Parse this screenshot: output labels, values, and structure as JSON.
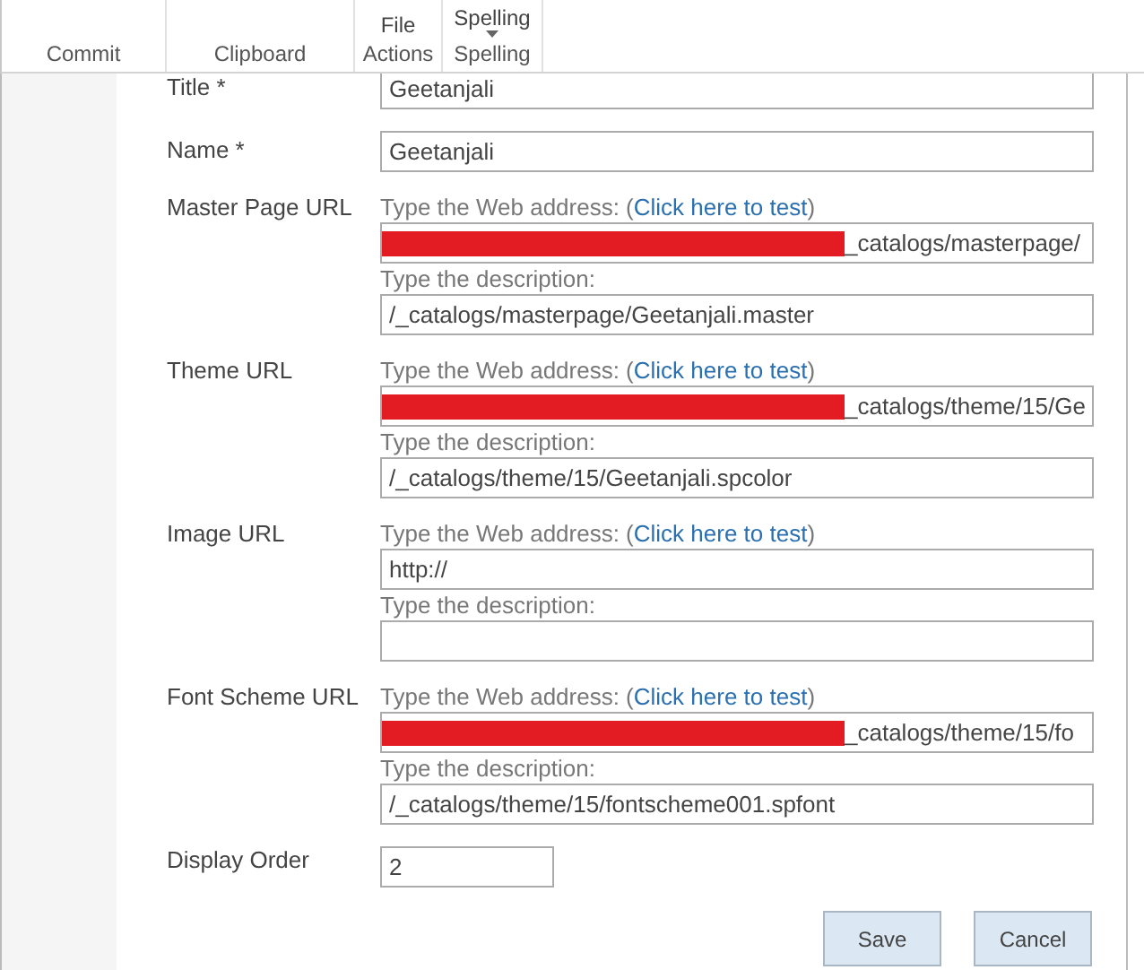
{
  "ribbon": {
    "groups": [
      {
        "label": "Commit"
      },
      {
        "label": "Clipboard"
      },
      {
        "label": "Actions",
        "button": "File",
        "dropdown": false
      },
      {
        "label": "Spelling",
        "button": "Spelling",
        "dropdown": true
      }
    ]
  },
  "fields": [
    {
      "kind": "text",
      "label": "Title *",
      "value": "Geetanjali"
    },
    {
      "kind": "text",
      "label": "Name *",
      "value": "Geetanjali"
    },
    {
      "kind": "url",
      "label": "Master Page URL",
      "address_prefix": "Type the Web address: (",
      "test_link": "Click here to test",
      "address_suffix": ")",
      "address": "_catalogs/masterpage/",
      "redacted": true,
      "description_label": "Type the description:",
      "description": "/_catalogs/masterpage/Geetanjali.master"
    },
    {
      "kind": "url",
      "label": "Theme URL",
      "address_prefix": "Type the Web address: (",
      "test_link": "Click here to test",
      "address_suffix": ")",
      "address": "_catalogs/theme/15/Ge",
      "redacted": true,
      "description_label": "Type the description:",
      "description": "/_catalogs/theme/15/Geetanjali.spcolor"
    },
    {
      "kind": "url",
      "label": "Image URL",
      "address_prefix": "Type the Web address: (",
      "test_link": "Click here to test",
      "address_suffix": ")",
      "address": "http://",
      "redacted": false,
      "description_label": "Type the description:"
    },
    {
      "kind": "url",
      "label": "Font Scheme URL",
      "address_prefix": "Type the Web address: (",
      "test_link": "Click here to test",
      "address_suffix": ")",
      "address": "_catalogs/theme/15/fo",
      "redacted": true,
      "description_label": "Type the description:",
      "description": "/_catalogs/theme/15/fontscheme001.spfont"
    },
    {
      "kind": "short",
      "label": "Display Order",
      "value": "2"
    }
  ],
  "buttons": [
    "Save",
    "Cancel"
  ]
}
